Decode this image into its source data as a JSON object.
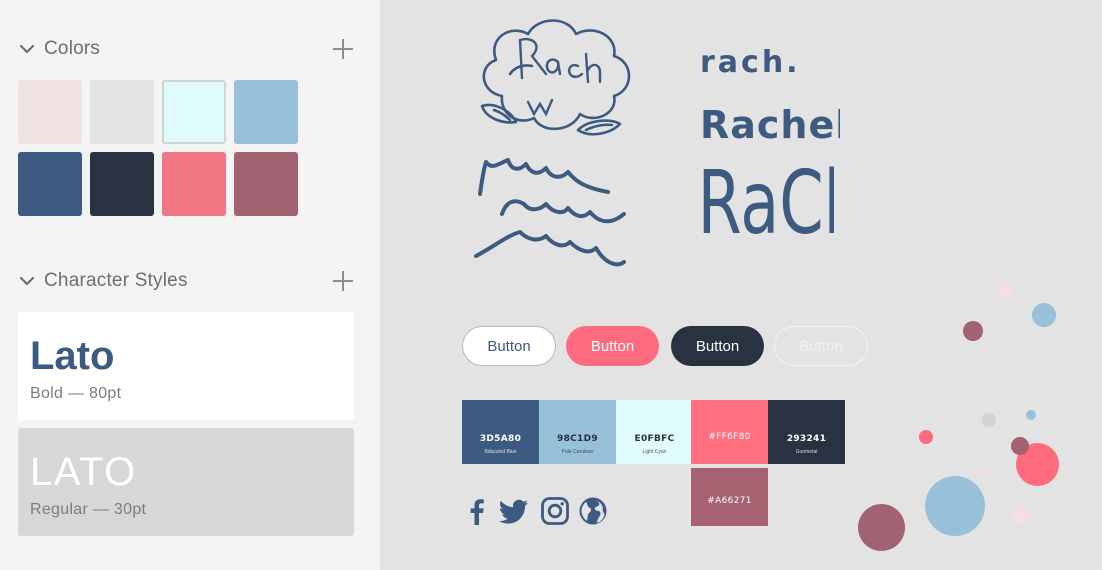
{
  "sidebar": {
    "colors": {
      "title": "Colors",
      "swatches": [
        {
          "name": "swatch-misty-rose",
          "color": "#f1e3e4"
        },
        {
          "name": "swatch-light-gray",
          "color": "#e4e4e4"
        },
        {
          "name": "swatch-light-cyan",
          "color": "#e0fbfc"
        },
        {
          "name": "swatch-pale-cerulean",
          "color": "#98c1d9"
        },
        {
          "name": "swatch-bdazzled-blue",
          "color": "#3d5a80"
        },
        {
          "name": "swatch-gunmetal",
          "color": "#293241"
        },
        {
          "name": "swatch-pink",
          "color": "#f27584"
        },
        {
          "name": "swatch-mauve",
          "color": "#a26271"
        }
      ]
    },
    "character_styles": {
      "title": "Character Styles",
      "styles": [
        {
          "name_text": "Lato",
          "meta": "Bold — 80pt"
        },
        {
          "name_text": "LATO",
          "meta": "Regular — 30pt"
        }
      ]
    }
  },
  "canvas": {
    "wordmarks": [
      "rach.",
      "Rachel",
      "RaCh"
    ],
    "buttons": [
      "Button",
      "Button",
      "Button",
      "Button"
    ],
    "palette": [
      {
        "hex": "3D5A80",
        "name": "Bdazzled Blue",
        "bg": "#3d5a80",
        "fg": "#ffffff"
      },
      {
        "hex": "98C1D9",
        "name": "Pale Cerulean",
        "bg": "#98c1d9",
        "fg": "#293241"
      },
      {
        "hex": "E0FBFC",
        "name": "Light Cyan",
        "bg": "#e0fbfc",
        "fg": "#293241"
      },
      {
        "hex": "#FF6F80",
        "name": "",
        "bg": "#ff6f80",
        "fg": "#ffffff"
      },
      {
        "hex": "293241",
        "name": "Gunmetal",
        "bg": "#293241",
        "fg": "#ffffff"
      },
      {
        "hex": "#A66271",
        "name": "",
        "bg": "#a66271",
        "fg": "#ffffff"
      }
    ],
    "social_icons": [
      "facebook-icon",
      "twitter-icon",
      "instagram-icon",
      "globe-icon"
    ],
    "accent_colors": {
      "blue": "#3d5a80",
      "pink": "#fe6b7e",
      "dark": "#293241",
      "cerulean": "#98c1d9",
      "mauve": "#a26271",
      "blush": "#f6dde2",
      "gray": "#cfcfcf"
    }
  }
}
